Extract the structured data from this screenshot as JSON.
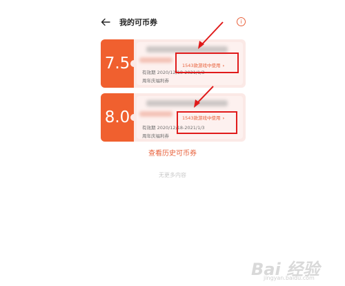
{
  "header": {
    "title": "我的可币券",
    "back_icon": "arrow-left-icon",
    "info_icon": "info-circle-icon",
    "info_glyph": "i"
  },
  "coupons": [
    {
      "value": "7.5",
      "use_link": "1543款游戏中使用",
      "chevron": "›",
      "validity": "有效期 2020/12/18-2021/1/3",
      "tag": "周年庆福利券"
    },
    {
      "value": "8.0",
      "use_link": "1543款游戏中使用",
      "chevron": "›",
      "validity": "有效期 2020/12/18-2021/1/3",
      "tag": "周年庆福利券"
    }
  ],
  "history_link": "查看历史可币券",
  "no_more": "无更多内容",
  "watermark": {
    "main": "Bai 经验",
    "sub": "jingyan.baidu.com"
  },
  "colors": {
    "accent": "#f0602f",
    "card_bg": "#fbe9e6",
    "highlight": "#e01a1a"
  }
}
